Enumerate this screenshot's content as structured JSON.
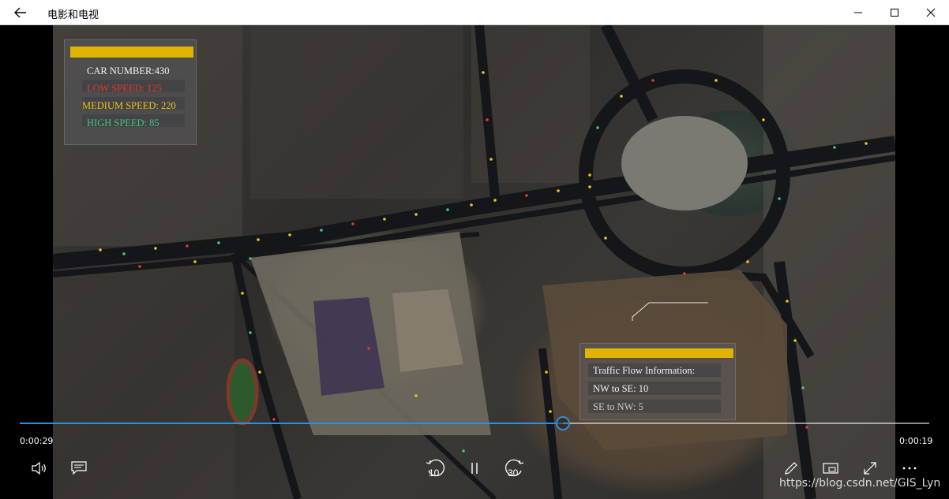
{
  "window": {
    "title": "电影和电视"
  },
  "video_overlay": {
    "stats": {
      "car_number": "CAR NUMBER:430",
      "low_speed": "LOW SPEED: 125",
      "medium_speed": "MEDIUM SPEED: 220",
      "high_speed": "HIGH SPEED: 85"
    },
    "traffic": {
      "title": "Traffic Flow Information:",
      "nw_to_se": "NW to SE: 10",
      "se_to_nw": "SE to NW: 5"
    },
    "colors": {
      "accent_bar": "#e2b400",
      "low": "#e03a2a",
      "medium": "#f2c21a",
      "high": "#3fc87a"
    }
  },
  "player": {
    "elapsed": "0:00:29",
    "remaining": "0:00:19",
    "progress": 0.6,
    "skip_back": "10",
    "skip_forward": "30",
    "accent": "#2e8fe0"
  },
  "watermark": "https://blog.csdn.net/GIS_Lyn"
}
